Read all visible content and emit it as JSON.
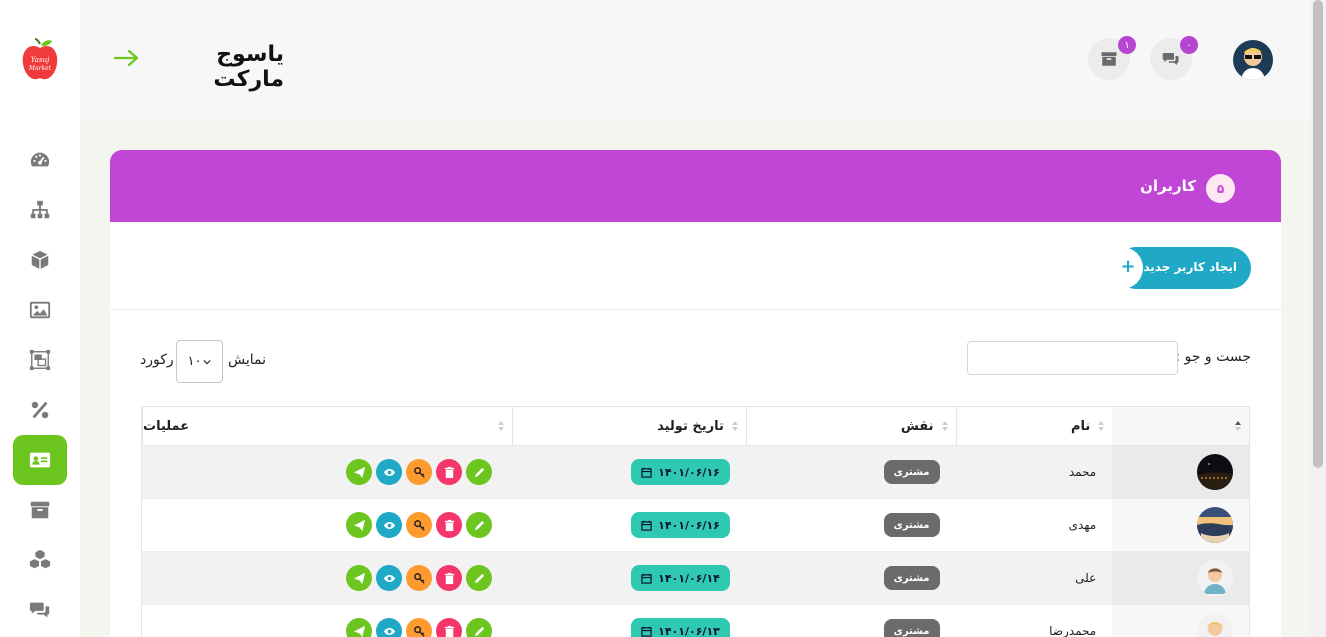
{
  "header": {
    "shop_title": "یاسوج مارکت",
    "archive_badge": "۱",
    "messages_badge": "۰"
  },
  "logo_text": "Yasuj Market",
  "sidebar": {
    "items": [
      {
        "name": "dashboard",
        "icon": "gauge-icon"
      },
      {
        "name": "categories",
        "icon": "sitemap-icon"
      },
      {
        "name": "products",
        "icon": "box-icon"
      },
      {
        "name": "gallery",
        "icon": "image-icon"
      },
      {
        "name": "banners",
        "icon": "object-group-icon"
      },
      {
        "name": "discounts",
        "icon": "percent-icon"
      },
      {
        "name": "users",
        "icon": "id-card-icon",
        "active": true
      },
      {
        "name": "archive",
        "icon": "archive-icon"
      },
      {
        "name": "packages",
        "icon": "cubes-icon"
      },
      {
        "name": "comments",
        "icon": "comments-icon"
      }
    ]
  },
  "card": {
    "title": "کاربران",
    "count": "۵",
    "add_button": "ایجاد کاربر جدید",
    "plus": "+"
  },
  "controls": {
    "search_label": "جست و جو :",
    "show_label": "نمایش",
    "records_label": "رکورد",
    "page_length": "۱۰"
  },
  "table": {
    "headers": {
      "avatar": "",
      "name": "نام",
      "role": "نقش",
      "date": "تاریخ تولید",
      "ops": "عملیات"
    },
    "rows": [
      {
        "name": "محمد",
        "role": "مشتری",
        "date": "۱۴۰۱/۰۶/۱۶",
        "avatar": "night"
      },
      {
        "name": "مهدی",
        "role": "مشتری",
        "date": "۱۴۰۱/۰۶/۱۶",
        "avatar": "sunset"
      },
      {
        "name": "علی",
        "role": "مشتری",
        "date": "۱۴۰۱/۰۶/۱۴",
        "avatar": "man"
      },
      {
        "name": "محمدرضا",
        "role": "مشتری",
        "date": "۱۴۰۱/۰۶/۱۳",
        "avatar": "blond"
      }
    ]
  },
  "colors": {
    "accent_purple": "#c146d6",
    "accent_green": "#6cc61f",
    "accent_blue": "#1fa9c6",
    "danger": "#f5366b",
    "warning": "#ff9a2e",
    "date_teal": "#2ec9b0"
  }
}
